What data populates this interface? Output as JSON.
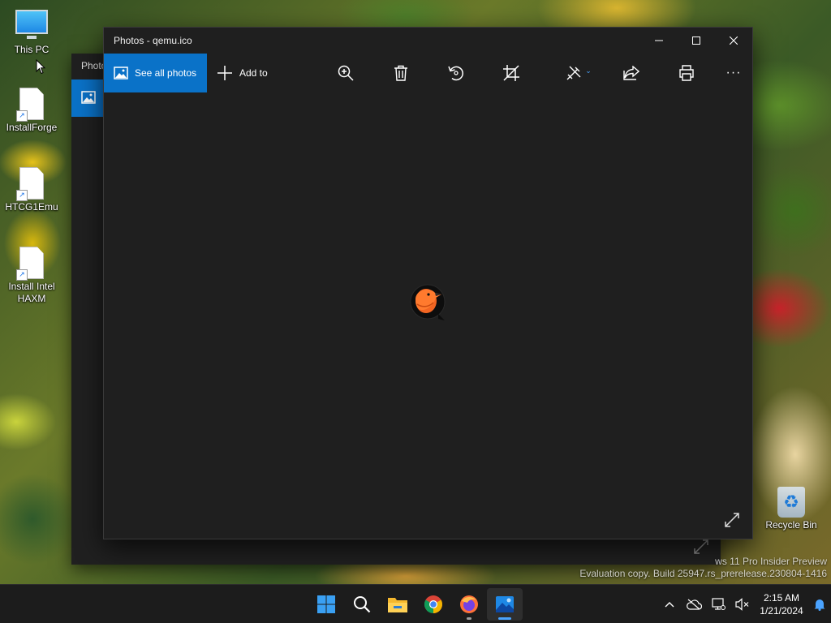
{
  "desktop": {
    "icons": [
      {
        "label": "This PC"
      },
      {
        "label": "InstallForge"
      },
      {
        "label": "HTCG1Emu"
      },
      {
        "label": "Install Intel HAXM"
      },
      {
        "label": "Recycle Bin"
      }
    ],
    "shortcut_glyph": "↗",
    "recycle_glyph": "♻"
  },
  "back_window": {
    "title": "Photo"
  },
  "photos_window": {
    "title": "Photos - qemu.ico",
    "toolbar": {
      "see_all_photos": "See all photos",
      "add_to": "Add to",
      "tools": [
        "zoom-icon",
        "delete-icon",
        "rotate-icon",
        "crop-icon",
        "edit-icon",
        "share-icon",
        "print-icon",
        "more-icon"
      ],
      "more_label": "···"
    },
    "image": {
      "name": "qemu-logo"
    }
  },
  "watermark": {
    "line1": "ws 11 Pro Insider Preview",
    "line2": "Evaluation copy. Build 25947.rs_prerelease.230804-1416"
  },
  "taskbar": {
    "apps": [
      "start-icon",
      "search-icon",
      "file-explorer-icon",
      "chrome-icon",
      "firefox-icon",
      "photos-icon"
    ],
    "clock": {
      "time": "2:15 AM",
      "date": "1/21/2024"
    },
    "tray_chevron": "^"
  },
  "colors": {
    "accent": "#0a72c8",
    "window_bg": "#1f1f1f",
    "taskbar_bg": "#1c1c1c"
  }
}
